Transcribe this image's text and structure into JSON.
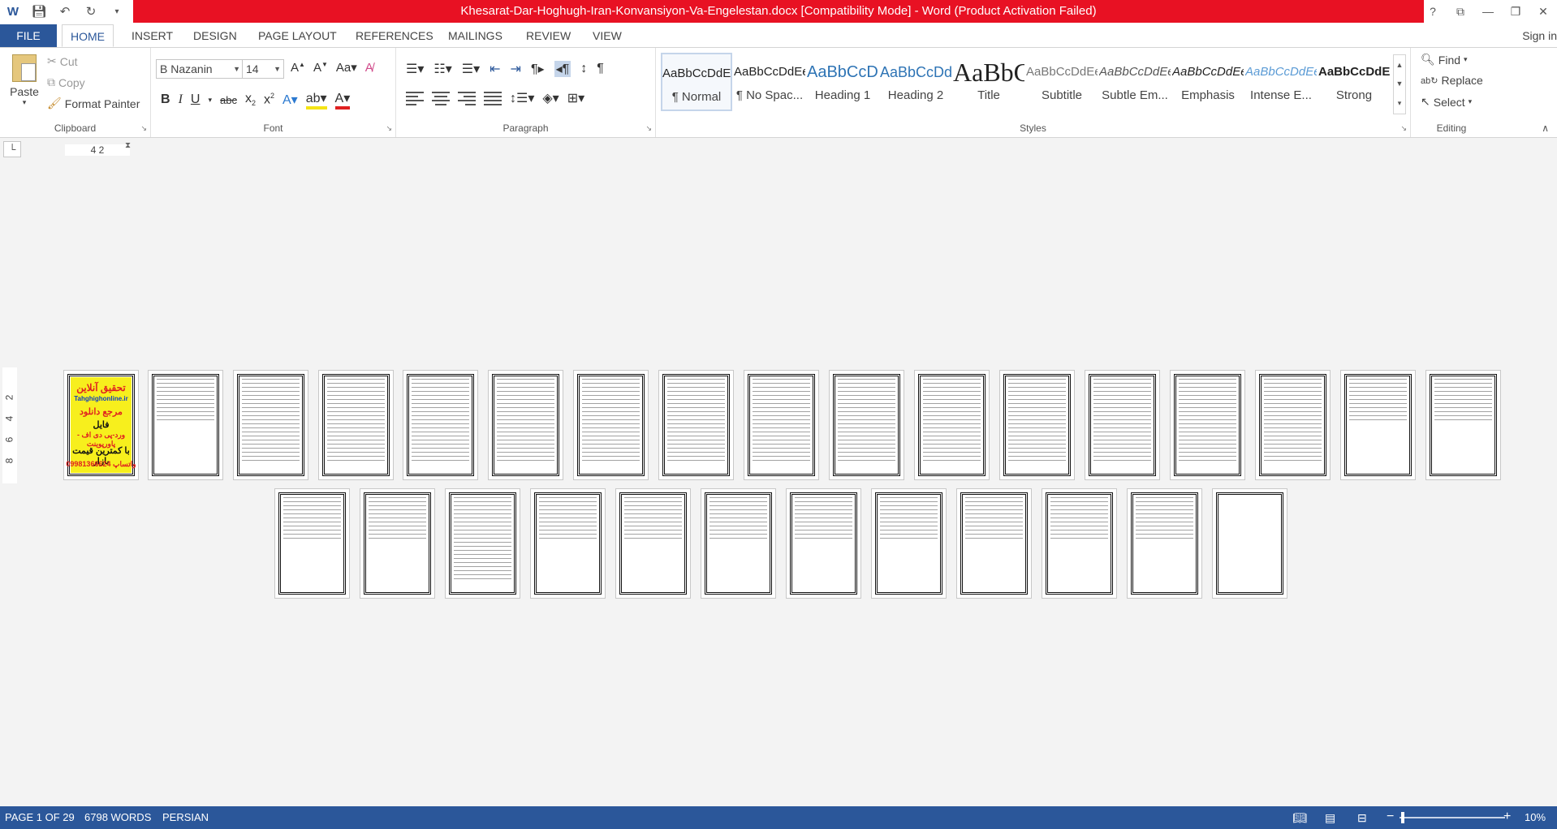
{
  "window": {
    "title": "Khesarat-Dar-Hoghugh-Iran-Konvansiyon-Va-Engelestan.docx [Compatibility Mode] -  Word (Product Activation Failed)",
    "help": "?"
  },
  "tabs": {
    "file": "FILE",
    "home": "HOME",
    "insert": "INSERT",
    "design": "DESIGN",
    "page_layout": "PAGE LAYOUT",
    "references": "REFERENCES",
    "mailings": "MAILINGS",
    "review": "REVIEW",
    "view": "VIEW",
    "signin": "Sign in"
  },
  "clipboard": {
    "paste": "Paste",
    "cut": "Cut",
    "copy": "Copy",
    "format_painter": "Format Painter",
    "label": "Clipboard"
  },
  "font": {
    "name": "B Nazanin",
    "size": "14",
    "label": "Font"
  },
  "paragraph": {
    "label": "Paragraph"
  },
  "styles": {
    "label": "Styles",
    "items": [
      {
        "sample": "AaBbCcDdEe",
        "name": "¶ Normal"
      },
      {
        "sample": "AaBbCcDdEe",
        "name": "¶ No Spac..."
      },
      {
        "sample": "AaBbCcDdEe",
        "name": "Heading 1"
      },
      {
        "sample": "AaBbCcDdEe",
        "name": "Heading 2"
      },
      {
        "sample": "AaBbCcDdEe",
        "name": "Title"
      },
      {
        "sample": "AaBbCcDdEe",
        "name": "Subtitle"
      },
      {
        "sample": "AaBbCcDdEe",
        "name": "Subtle Em..."
      },
      {
        "sample": "AaBbCcDdEe",
        "name": "Emphasis"
      },
      {
        "sample": "AaBbCcDdEe",
        "name": "Intense E..."
      },
      {
        "sample": "AaBbCcDdEe",
        "name": "Strong"
      }
    ]
  },
  "editing": {
    "find": "Find",
    "replace": "Replace",
    "select": "Select",
    "label": "Editing"
  },
  "ruler": {
    "h": "4  2",
    "v": [
      "2",
      "4",
      "6",
      "8"
    ]
  },
  "cover": {
    "line1": "تحقیق آنلاین",
    "line2": "Tahghighonline.ir",
    "line3": "مرجع دانلود",
    "line4": "فایل",
    "line5": "ورد-پی دی اف - پاورپوینت",
    "line6": "با کمترین قیمت بازار",
    "line7": "09981366624 واتساپ"
  },
  "status": {
    "page": "PAGE 1 OF 29",
    "words": "6798 WORDS",
    "language": "PERSIAN",
    "zoom": "10%"
  },
  "colors": {
    "accent": "#2b579a",
    "title_bar": "#e81123",
    "cover_yellow": "#f7ef1d"
  }
}
